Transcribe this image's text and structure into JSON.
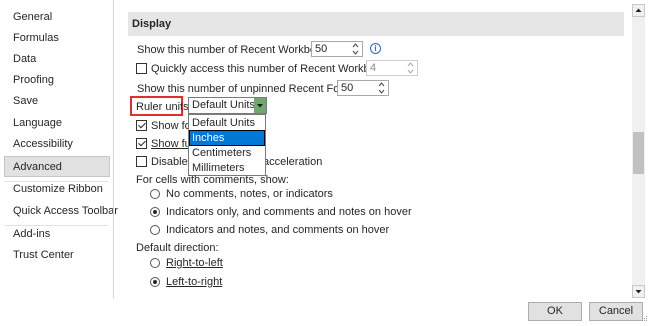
{
  "sidebar": {
    "items": [
      {
        "label": "General"
      },
      {
        "label": "Formulas"
      },
      {
        "label": "Data"
      },
      {
        "label": "Proofing"
      },
      {
        "label": "Save"
      },
      {
        "label": "Language"
      },
      {
        "label": "Accessibility"
      },
      {
        "label": "Advanced",
        "selected": true
      },
      {
        "label": "Customize Ribbon"
      },
      {
        "label": "Quick Access Toolbar"
      },
      {
        "label": "Add-ins"
      },
      {
        "label": "Trust Center"
      }
    ]
  },
  "section": {
    "title": "Display",
    "recent_workbooks_label": "Show this number of Recent Workbooks:",
    "recent_workbooks_value": "50",
    "quick_access_label": "Quickly access this number of Recent Workbooks:",
    "quick_access_value": "4",
    "quick_access_checked": false,
    "recent_folders_label": "Show this number of unpinned Recent Folders:",
    "recent_folders_value": "50",
    "ruler_units_label": "Ruler units",
    "ruler_units_value": "Default Units",
    "ruler_units_options": [
      "Default Units",
      "Inches",
      "Centimeters",
      "Millimeters"
    ],
    "ruler_units_highlighted": "Inches",
    "show_formula_bar_label": "Show for",
    "show_formula_bar_checked": true,
    "show_function_label": "Show fu",
    "show_function_checked": true,
    "disable_hw_label_left": "Disable h",
    "disable_hw_label_right": "acceleration",
    "disable_hw_checked": false,
    "comments_header": "For cells with comments, show:",
    "comments_options": [
      {
        "label": "No comments, notes, or indicators",
        "selected": false
      },
      {
        "label": "Indicators only, and comments and notes on hover",
        "selected": true
      },
      {
        "label": "Indicators and notes, and comments on hover",
        "selected": false
      }
    ],
    "direction_header": "Default direction:",
    "direction_options": [
      {
        "label": "Right-to-left",
        "selected": false
      },
      {
        "label": "Left-to-right",
        "selected": true
      }
    ]
  },
  "footer": {
    "ok_label": "OK",
    "cancel_label": "Cancel"
  },
  "colors": {
    "highlight_box": "#e0302b",
    "selection": "#0078d7",
    "combo_button": "#6fa86f",
    "info_icon": "#2b6cc4"
  }
}
